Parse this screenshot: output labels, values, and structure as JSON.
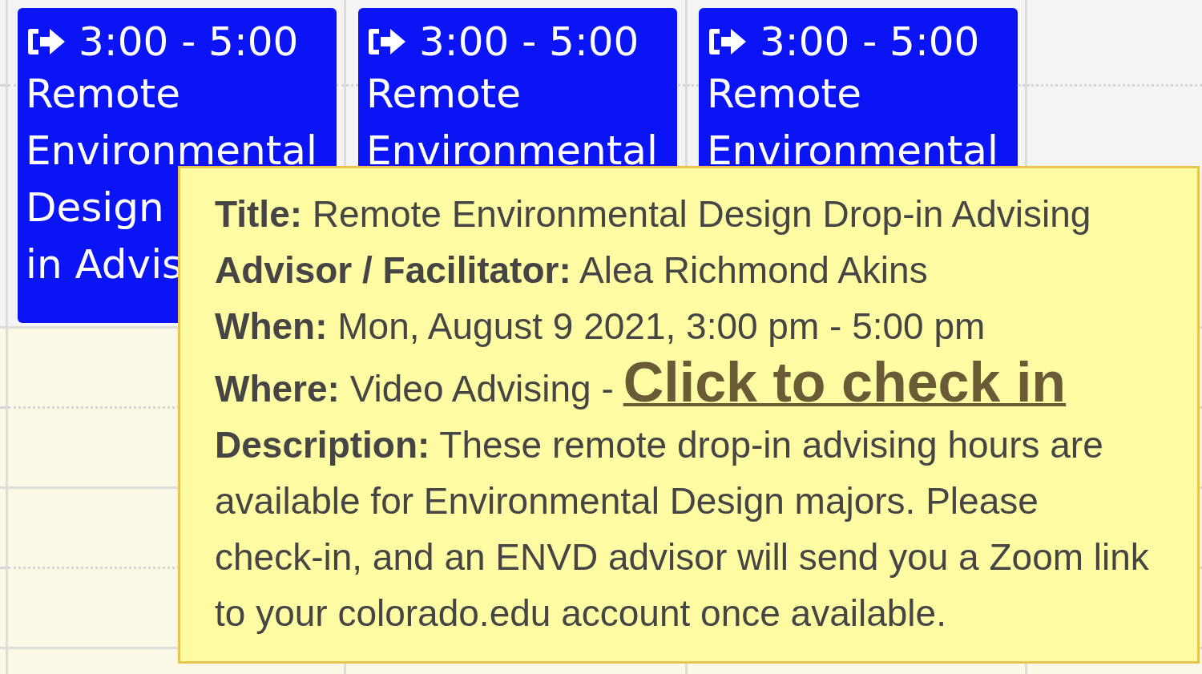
{
  "events": [
    {
      "time": "3:00 - 5:00",
      "title_lines": [
        "Remote",
        "Environmental",
        "Design",
        "in Advis"
      ]
    },
    {
      "time": "3:00 - 5:00",
      "title_lines": [
        "Remote",
        "Environmental"
      ]
    },
    {
      "time": "3:00 - 5:00",
      "title_lines": [
        "Remote",
        "Environmental"
      ]
    }
  ],
  "tooltip": {
    "lines": [
      {
        "kind": "text",
        "text": "**Title:** Remote Environmental Design Drop-in Advising"
      },
      {
        "kind": "text",
        "text": "**Advisor / Facilitator:** Alea Richmond Akins"
      },
      {
        "kind": "text",
        "text": "**When:** Mon, August 9 2021, 3:00 pm - 5:00 pm"
      },
      {
        "kind": "link",
        "text": "**Where:** Video Advising -",
        "link": "Click to check in"
      },
      {
        "kind": "text",
        "text": "**Description:** These remote drop-in advising hours are available for Environmental Design majors. Please check-in, and an ENVD advisor will send you a Zoom link to your colorado.edu account once available."
      }
    ]
  }
}
